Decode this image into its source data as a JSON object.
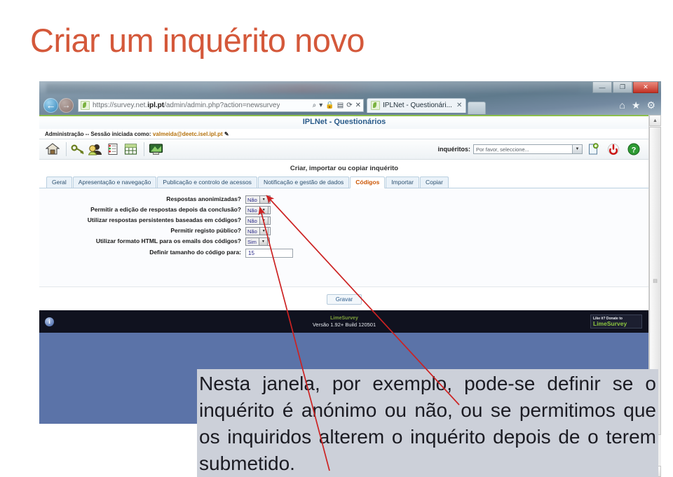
{
  "slide": {
    "title": "Criar um inquérito novo",
    "title_color": "#d4583a",
    "caption": "Nesta janela, por exemplo, pode-se definir se o inquérito é anónimo ou não, ou se permitimos que os inquiridos alterem o inquérito depois de o terem submetido."
  },
  "browser": {
    "url": "https://survey.net.ipl.pt/admin/admin.php?action=newsurvey",
    "url_bold": "ipl.pt",
    "url_prefix": "https://survey.net.",
    "url_suffix": "/admin/admin.php?action=newsurvey",
    "tab_title": "IPLNet - Questionári...",
    "tab_close": "✕",
    "back_glyph": "←",
    "forward_glyph": "→",
    "url_icons": [
      "⌕",
      "▾",
      "🔒",
      "▤",
      "⟳",
      "✕"
    ],
    "window_buttons": {
      "minimize": "—",
      "maximize": "❐",
      "close": "✕"
    },
    "toolbar_icons": [
      "⌂",
      "★",
      "⚙"
    ]
  },
  "app": {
    "banner": "IPLNet - Questionários",
    "admin_prefix": "Administração -- Sessão iniciada como:",
    "admin_user": "valmeida@deetc.isel.ipl.pt",
    "toolbar_icons": [
      {
        "name": "home-icon",
        "glyph": "⌂"
      },
      {
        "name": "key-icon",
        "glyph": "🔑"
      },
      {
        "name": "users-icon",
        "glyph": "👥"
      },
      {
        "name": "document-icon",
        "glyph": "📄"
      },
      {
        "name": "table-icon",
        "glyph": "▦"
      },
      {
        "name": "display-icon",
        "glyph": "🖵"
      }
    ],
    "survey_selector": {
      "label": "inquéritos:",
      "value": "Por favor, seleccione...",
      "arrow": "▼"
    },
    "right_icons": [
      {
        "name": "new-survey-icon",
        "glyph": "🗋"
      },
      {
        "name": "power-icon",
        "glyph": "⏻"
      },
      {
        "name": "help-icon",
        "glyph": "?"
      }
    ],
    "section_title": "Criar, importar ou copiar inquérito",
    "tabs": [
      {
        "label": "Geral",
        "active": false
      },
      {
        "label": "Apresentação e navegação",
        "active": false
      },
      {
        "label": "Publicação e controlo de acessos",
        "active": false
      },
      {
        "label": "Notificação e gestão de dados",
        "active": false
      },
      {
        "label": "Códigos",
        "active": true
      },
      {
        "label": "Importar",
        "active": false
      },
      {
        "label": "Copiar",
        "active": false
      }
    ],
    "form": {
      "rows": [
        {
          "label": "Respostas anonimizadas?",
          "type": "select",
          "value": "Não"
        },
        {
          "label": "Permitir a edição de respostas depois da conclusão?",
          "type": "select",
          "value": "Não"
        },
        {
          "label": "Utilizar respostas persistentes baseadas em códigos?",
          "type": "select",
          "value": "Não"
        },
        {
          "label": "Permitir registo público?",
          "type": "select",
          "value": "Não"
        },
        {
          "label": "Utilizar formato HTML para os emails dos códigos?",
          "type": "select",
          "value": "Sim"
        },
        {
          "label": "Definir tamanho do código para:",
          "type": "text",
          "value": "15"
        }
      ],
      "save_label": "Gravar"
    },
    "footer": {
      "product": "LimeSurvey",
      "version": "Versão 1.92+ Build 120501",
      "info_glyph": "i",
      "donate_line1": "Like it? Donate to",
      "donate_line2": "LimeSurvey"
    }
  },
  "scrollbar": {
    "up": "▲",
    "down": "▼",
    "grip": "▤"
  },
  "colors": {
    "title": "#d4583a",
    "blue_page": "#5b73a8",
    "footer_dark": "#10121f",
    "accent_tab": "#cc5500",
    "arrow_red": "#cc2222",
    "caption_bg": "#ccd0d9"
  }
}
